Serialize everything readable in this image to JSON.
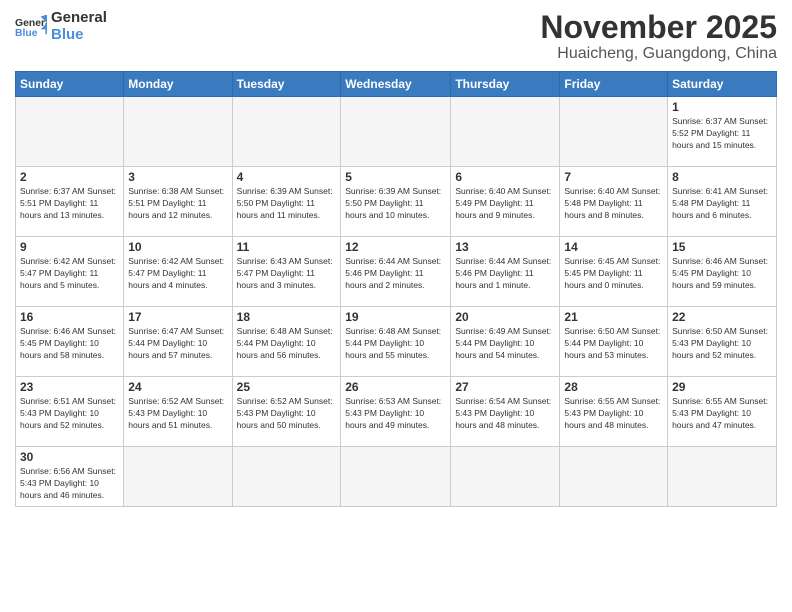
{
  "header": {
    "logo_general": "General",
    "logo_blue": "Blue",
    "month_title": "November 2025",
    "location": "Huaicheng, Guangdong, China"
  },
  "weekdays": [
    "Sunday",
    "Monday",
    "Tuesday",
    "Wednesday",
    "Thursday",
    "Friday",
    "Saturday"
  ],
  "weeks": [
    [
      {
        "day": "",
        "info": ""
      },
      {
        "day": "",
        "info": ""
      },
      {
        "day": "",
        "info": ""
      },
      {
        "day": "",
        "info": ""
      },
      {
        "day": "",
        "info": ""
      },
      {
        "day": "",
        "info": ""
      },
      {
        "day": "1",
        "info": "Sunrise: 6:37 AM\nSunset: 5:52 PM\nDaylight: 11 hours and 15 minutes."
      }
    ],
    [
      {
        "day": "2",
        "info": "Sunrise: 6:37 AM\nSunset: 5:51 PM\nDaylight: 11 hours and 13 minutes."
      },
      {
        "day": "3",
        "info": "Sunrise: 6:38 AM\nSunset: 5:51 PM\nDaylight: 11 hours and 12 minutes."
      },
      {
        "day": "4",
        "info": "Sunrise: 6:39 AM\nSunset: 5:50 PM\nDaylight: 11 hours and 11 minutes."
      },
      {
        "day": "5",
        "info": "Sunrise: 6:39 AM\nSunset: 5:50 PM\nDaylight: 11 hours and 10 minutes."
      },
      {
        "day": "6",
        "info": "Sunrise: 6:40 AM\nSunset: 5:49 PM\nDaylight: 11 hours and 9 minutes."
      },
      {
        "day": "7",
        "info": "Sunrise: 6:40 AM\nSunset: 5:48 PM\nDaylight: 11 hours and 8 minutes."
      },
      {
        "day": "8",
        "info": "Sunrise: 6:41 AM\nSunset: 5:48 PM\nDaylight: 11 hours and 6 minutes."
      }
    ],
    [
      {
        "day": "9",
        "info": "Sunrise: 6:42 AM\nSunset: 5:47 PM\nDaylight: 11 hours and 5 minutes."
      },
      {
        "day": "10",
        "info": "Sunrise: 6:42 AM\nSunset: 5:47 PM\nDaylight: 11 hours and 4 minutes."
      },
      {
        "day": "11",
        "info": "Sunrise: 6:43 AM\nSunset: 5:47 PM\nDaylight: 11 hours and 3 minutes."
      },
      {
        "day": "12",
        "info": "Sunrise: 6:44 AM\nSunset: 5:46 PM\nDaylight: 11 hours and 2 minutes."
      },
      {
        "day": "13",
        "info": "Sunrise: 6:44 AM\nSunset: 5:46 PM\nDaylight: 11 hours and 1 minute."
      },
      {
        "day": "14",
        "info": "Sunrise: 6:45 AM\nSunset: 5:45 PM\nDaylight: 11 hours and 0 minutes."
      },
      {
        "day": "15",
        "info": "Sunrise: 6:46 AM\nSunset: 5:45 PM\nDaylight: 10 hours and 59 minutes."
      }
    ],
    [
      {
        "day": "16",
        "info": "Sunrise: 6:46 AM\nSunset: 5:45 PM\nDaylight: 10 hours and 58 minutes."
      },
      {
        "day": "17",
        "info": "Sunrise: 6:47 AM\nSunset: 5:44 PM\nDaylight: 10 hours and 57 minutes."
      },
      {
        "day": "18",
        "info": "Sunrise: 6:48 AM\nSunset: 5:44 PM\nDaylight: 10 hours and 56 minutes."
      },
      {
        "day": "19",
        "info": "Sunrise: 6:48 AM\nSunset: 5:44 PM\nDaylight: 10 hours and 55 minutes."
      },
      {
        "day": "20",
        "info": "Sunrise: 6:49 AM\nSunset: 5:44 PM\nDaylight: 10 hours and 54 minutes."
      },
      {
        "day": "21",
        "info": "Sunrise: 6:50 AM\nSunset: 5:44 PM\nDaylight: 10 hours and 53 minutes."
      },
      {
        "day": "22",
        "info": "Sunrise: 6:50 AM\nSunset: 5:43 PM\nDaylight: 10 hours and 52 minutes."
      }
    ],
    [
      {
        "day": "23",
        "info": "Sunrise: 6:51 AM\nSunset: 5:43 PM\nDaylight: 10 hours and 52 minutes."
      },
      {
        "day": "24",
        "info": "Sunrise: 6:52 AM\nSunset: 5:43 PM\nDaylight: 10 hours and 51 minutes."
      },
      {
        "day": "25",
        "info": "Sunrise: 6:52 AM\nSunset: 5:43 PM\nDaylight: 10 hours and 50 minutes."
      },
      {
        "day": "26",
        "info": "Sunrise: 6:53 AM\nSunset: 5:43 PM\nDaylight: 10 hours and 49 minutes."
      },
      {
        "day": "27",
        "info": "Sunrise: 6:54 AM\nSunset: 5:43 PM\nDaylight: 10 hours and 48 minutes."
      },
      {
        "day": "28",
        "info": "Sunrise: 6:55 AM\nSunset: 5:43 PM\nDaylight: 10 hours and 48 minutes."
      },
      {
        "day": "29",
        "info": "Sunrise: 6:55 AM\nSunset: 5:43 PM\nDaylight: 10 hours and 47 minutes."
      }
    ],
    [
      {
        "day": "30",
        "info": "Sunrise: 6:56 AM\nSunset: 5:43 PM\nDaylight: 10 hours and 46 minutes."
      },
      {
        "day": "",
        "info": ""
      },
      {
        "day": "",
        "info": ""
      },
      {
        "day": "",
        "info": ""
      },
      {
        "day": "",
        "info": ""
      },
      {
        "day": "",
        "info": ""
      },
      {
        "day": "",
        "info": ""
      }
    ]
  ]
}
